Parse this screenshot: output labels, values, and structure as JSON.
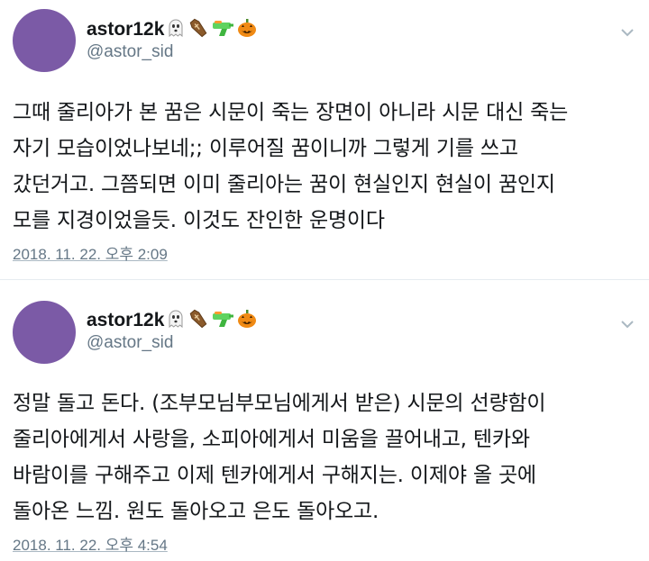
{
  "tweets": [
    {
      "user": {
        "name": "astor12k",
        "handle": "@astor_sid",
        "avatar_color": "#7b5aa6"
      },
      "name_emojis": [
        "ghost-icon",
        "coffin-icon",
        "water-pistol-icon",
        "jack-o-lantern-icon"
      ],
      "lines": [
        "그때 줄리아가 본 꿈은 시문이 죽는 장면이 아니라 시문 대신 죽는",
        "자기 모습이었나보네;; 이루어질 꿈이니까 그렇게 기를 쓰고",
        "갔던거고. 그쯤되면 이미 줄리아는 꿈이 현실인지 현실이 꿈인지",
        "모를 지경이었을듯. 이것도 잔인한 운명이다"
      ],
      "timestamp": "2018. 11. 22. 오후 2:09"
    },
    {
      "user": {
        "name": "astor12k",
        "handle": "@astor_sid",
        "avatar_color": "#7b5aa6"
      },
      "name_emojis": [
        "ghost-icon",
        "coffin-icon",
        "water-pistol-icon",
        "jack-o-lantern-icon"
      ],
      "lines": [
        "정말 돌고 돈다. (조부모님부모님에게서 받은) 시문의 선량함이",
        "줄리아에게서 사랑을, 소피아에게서 미움을 끌어내고, 텐카와",
        "바람이를 구해주고 이제 텐카에게서 구해지는. 이제야 올 곳에",
        "돌아온 느낌. 원도 돌아오고 은도 돌아오고."
      ],
      "timestamp": "2018. 11. 22. 오후 4:54"
    }
  ],
  "colors": {
    "text": "#14171a",
    "secondary": "#657786",
    "divider": "#e6ecf0"
  }
}
